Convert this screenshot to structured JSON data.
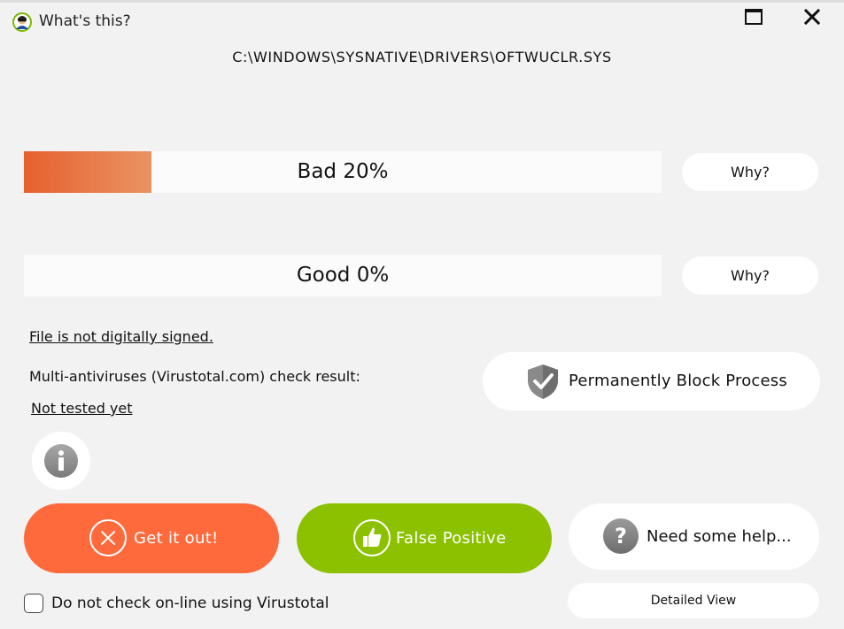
{
  "window": {
    "title": "What's this?",
    "maximize_icon": "maximize-icon",
    "close_icon": "close-icon"
  },
  "file_path": "C:\\WINDOWS\\SYSNATIVE\\DRIVERS\\OFTWUCLR.SYS",
  "ratings": {
    "bad": {
      "label": "Bad 20%",
      "percent": 20,
      "why_label": "Why?",
      "fill_color": "#e5612e"
    },
    "good": {
      "label": "Good 0%",
      "percent": 0,
      "why_label": "Why?"
    }
  },
  "signature_link": "File is not digitally signed.",
  "virustotal": {
    "label": "Multi-antiviruses (Virustotal.com) check result:",
    "result_link": "Not tested yet"
  },
  "buttons": {
    "block": {
      "label": "Permanently Block Process",
      "icon": "shield-check-icon"
    },
    "info": {
      "icon": "info-icon"
    },
    "get_it_out": {
      "label": "Get it out!",
      "icon": "close-circle-icon",
      "color": "#ff6a3d"
    },
    "false_positive": {
      "label": "False Positive",
      "icon": "thumbs-up-icon",
      "color": "#8cc100"
    },
    "help": {
      "label": "Need some help...",
      "icon": "question-icon"
    },
    "detailed_view": {
      "label": "Detailed View"
    }
  },
  "options": {
    "no_online_check": {
      "label": "Do not check on-line using Virustotal",
      "checked": false
    }
  }
}
